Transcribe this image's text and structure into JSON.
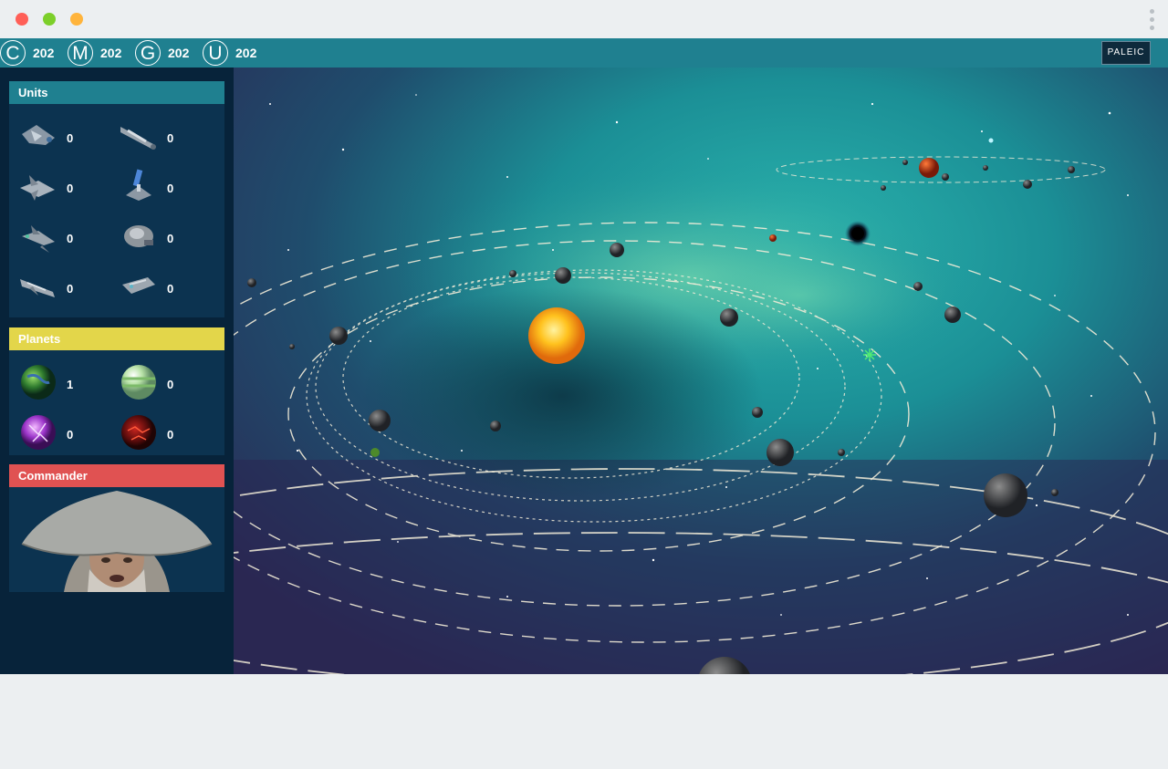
{
  "window": {
    "title_buttons": [
      "close",
      "minimize",
      "zoom"
    ]
  },
  "resources": [
    {
      "letter": "C",
      "value": "202"
    },
    {
      "letter": "M",
      "value": "202"
    },
    {
      "letter": "G",
      "value": "202"
    },
    {
      "letter": "U",
      "value": "202"
    }
  ],
  "logo": {
    "text": "PALEIC"
  },
  "sidebar": {
    "units": {
      "title": "Units",
      "header_color": "#1f8090",
      "items": [
        {
          "icon": "fighter-ship-icon",
          "count": "0"
        },
        {
          "icon": "cruiser-ship-icon",
          "count": "0"
        },
        {
          "icon": "interceptor-ship-icon",
          "count": "0"
        },
        {
          "icon": "satellite-icon",
          "count": "0"
        },
        {
          "icon": "scout-ship-icon",
          "count": "0"
        },
        {
          "icon": "freighter-ship-icon",
          "count": "0"
        },
        {
          "icon": "frigate-ship-icon",
          "count": "0"
        },
        {
          "icon": "transport-ship-icon",
          "count": "0"
        }
      ]
    },
    "planets": {
      "title": "Planets",
      "header_color": "#e3d64a",
      "items": [
        {
          "icon": "earth-planet-icon",
          "count": "1"
        },
        {
          "icon": "gas-planet-icon",
          "count": "0"
        },
        {
          "icon": "crystal-planet-icon",
          "count": "0"
        },
        {
          "icon": "lava-planet-icon",
          "count": "0"
        }
      ]
    },
    "commander": {
      "title": "Commander",
      "header_color": "#e05252",
      "avatar": "commander-portrait"
    }
  },
  "colors": {
    "topbar": "#1f8090",
    "sidebar": "#07233a",
    "panel": "#0c3350"
  }
}
